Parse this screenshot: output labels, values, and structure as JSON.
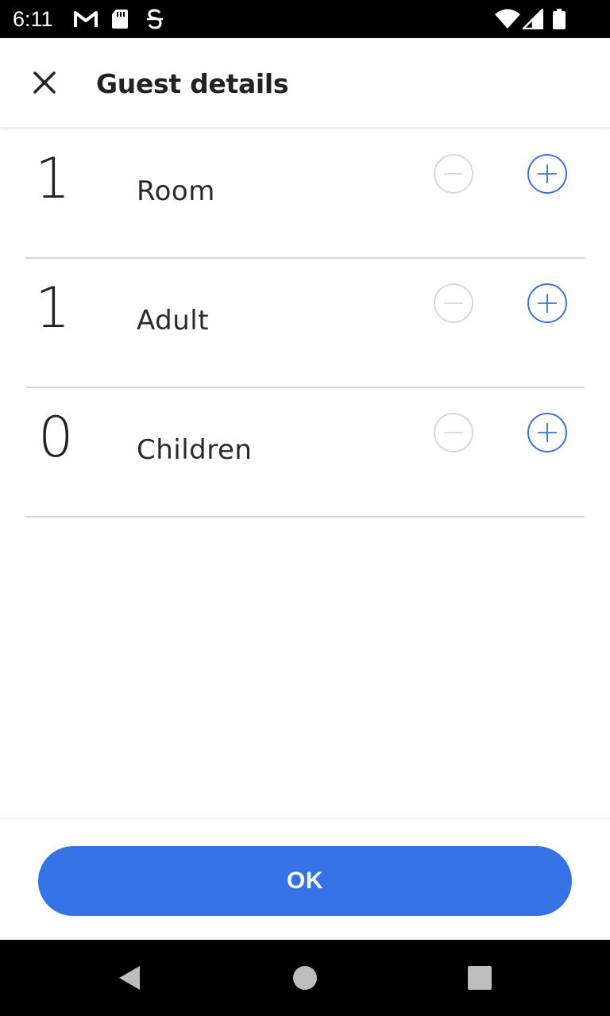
{
  "status_bar": {
    "time": "6:11",
    "icons": [
      "gmail-icon",
      "sd-card-icon",
      "s-app-icon",
      "wifi-icon",
      "signal-icon",
      "battery-icon"
    ]
  },
  "header": {
    "title": "Guest details",
    "close_icon": "close-icon"
  },
  "rows": [
    {
      "count": "1",
      "label": "Room"
    },
    {
      "count": "1",
      "label": "Adult"
    },
    {
      "count": "0",
      "label": "Children"
    }
  ],
  "stepper_icons": {
    "decrement": "minus-circle-icon",
    "increment": "plus-circle-icon"
  },
  "footer": {
    "ok_label": "OK"
  },
  "nav_bar": {
    "icons": [
      "back-icon",
      "home-icon",
      "recents-icon"
    ]
  },
  "colors": {
    "accent": "#3572e6",
    "disabled": "#d8d8d8",
    "text": "#222222",
    "divider": "#d6d6d6"
  }
}
